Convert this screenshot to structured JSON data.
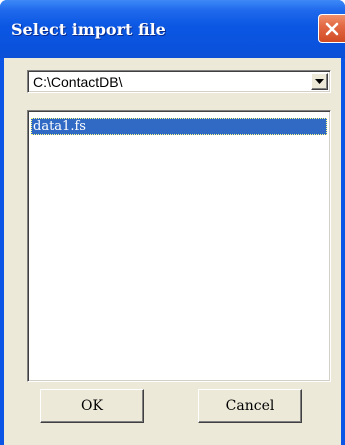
{
  "window": {
    "title": "Select import file",
    "close_icon": "close-icon",
    "colors": {
      "titlebar": "#0b57e3",
      "close_button": "#e26a44",
      "client": "#ece9d8",
      "selection": "#316ac5"
    }
  },
  "directory": {
    "value": "C:\\ContactDB\\",
    "dropdown_icon": "chevron-down-icon"
  },
  "files": {
    "items": [
      "data1.fs"
    ],
    "selected_index": 0
  },
  "buttons": {
    "ok_label": "OK",
    "cancel_label": "Cancel"
  }
}
